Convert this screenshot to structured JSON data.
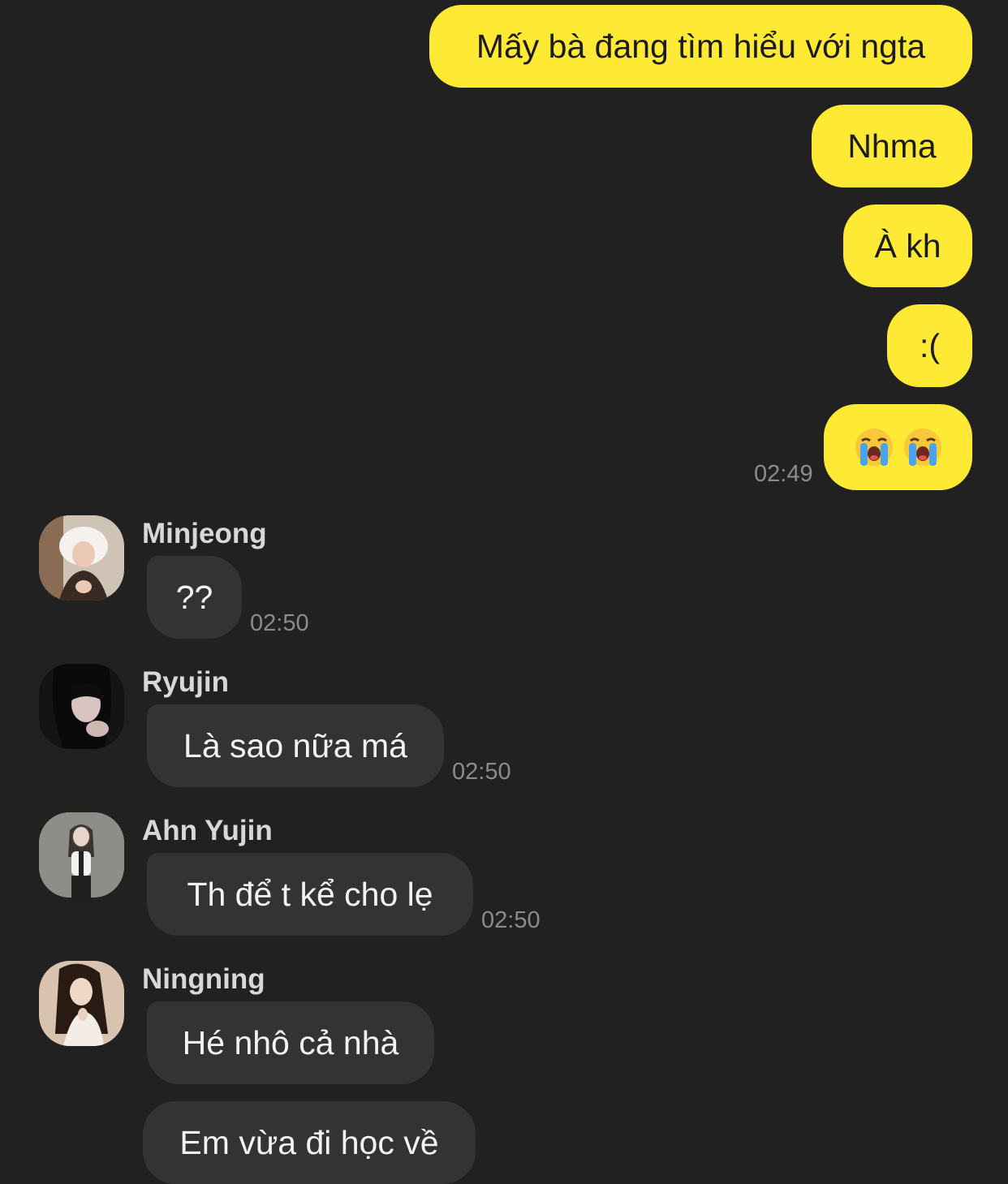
{
  "outgoing": [
    {
      "text": "Mấy bà đang tìm hiểu với ngta"
    },
    {
      "text": "Nhma"
    },
    {
      "text": "À kh"
    },
    {
      "text": ":("
    },
    {
      "emojis": [
        "loudly-crying-face",
        "loudly-crying-face"
      ],
      "time": "02:49"
    }
  ],
  "incoming": [
    {
      "sender": "Minjeong",
      "messages": [
        "??"
      ],
      "time": "02:50"
    },
    {
      "sender": "Ryujin",
      "messages": [
        "Là sao nữa má"
      ],
      "time": "02:50"
    },
    {
      "sender": "Ahn Yujin",
      "messages": [
        "Th để t kể cho lẹ"
      ],
      "time": "02:50"
    },
    {
      "sender": "Ningning",
      "messages": [
        "Hé nhô cả nhà",
        "Em vừa đi học về"
      ]
    }
  ],
  "colors": {
    "background": "#212121",
    "outgoing_bubble": "#fee935",
    "incoming_bubble": "#333333",
    "timestamp": "#8b8b8b",
    "sender_name": "#d8d8d8"
  }
}
